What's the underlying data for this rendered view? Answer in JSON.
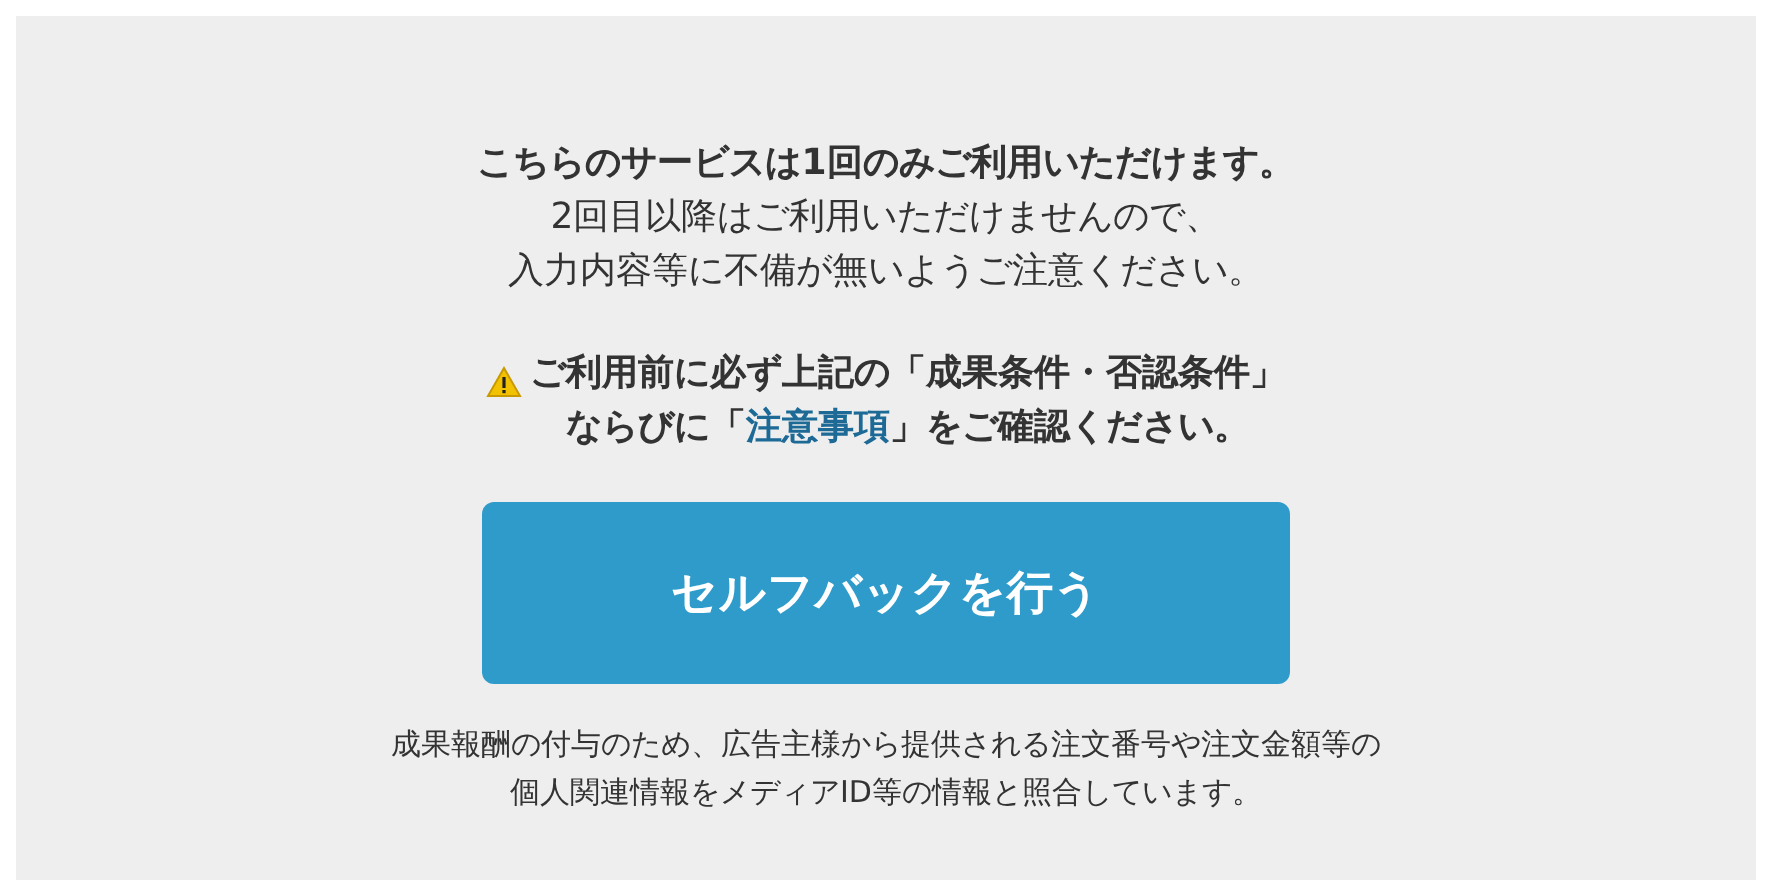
{
  "notice": {
    "title": "こちらのサービスは1回のみご利用いただけます。",
    "lines": [
      "2回目以降はご利用いただけませんので、",
      "入力内容等に不備が無いようご注意ください。"
    ]
  },
  "warning": {
    "line_1": "ご利用前に必ず上記の「成果条件・否認条件」",
    "line_2_before": "ならびに「",
    "link": "注意事項",
    "line_2_after": "」をご確認ください。"
  },
  "button": {
    "label": "セルフバックを行う"
  },
  "footnote": {
    "lines": [
      "成果報酬の付与のため、広告主様から提供される注文番号や注文金額等の",
      "個人関連情報をメディアID等の情報と照合しています。"
    ]
  }
}
